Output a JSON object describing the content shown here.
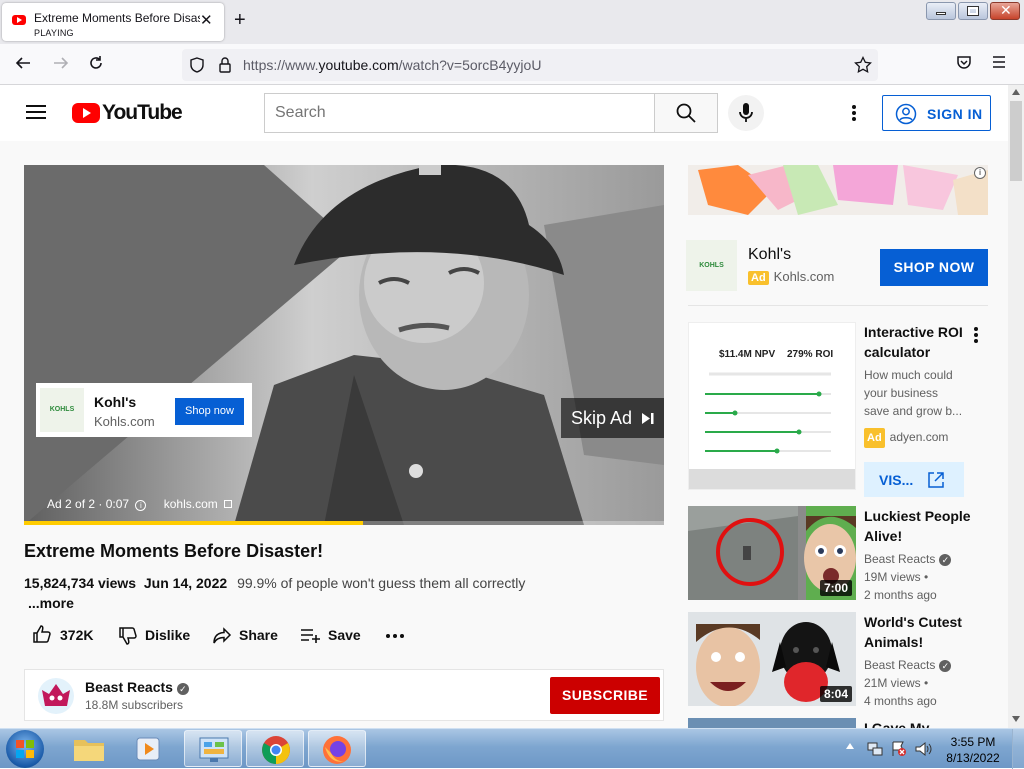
{
  "browser": {
    "tab_title": "Extreme Moments Before Disaster!",
    "tab_status": "PLAYING",
    "url_prefix": "https://www.",
    "url_host": "youtube.com",
    "url_path": "/watch?v=5orcB4yyjoU"
  },
  "header": {
    "logo_text": "YouTube",
    "search_placeholder": "Search",
    "sign_in_label": "SIGN IN"
  },
  "player": {
    "ad_card": {
      "logo_text": "KOHLS",
      "title": "Kohl's",
      "domain": "Kohls.com",
      "button": "Shop now"
    },
    "skip_label": "Skip Ad",
    "ad_counter": "Ad 2 of 2 · 0:07",
    "ad_domain": "kohls.com",
    "progress": 0.53
  },
  "video": {
    "title": "Extreme Moments Before Disaster!",
    "views": "15,824,734 views",
    "date": "Jun 14, 2022",
    "description": "99.9% of people won't guess them all correctly",
    "more_label": "...more",
    "likes": "372K",
    "dislike_label": "Dislike",
    "share_label": "Share",
    "save_label": "Save",
    "channel": {
      "name": "Beast Reacts",
      "subscribers": "18.8M subscribers",
      "subscribe_label": "SUBSCRIBE"
    }
  },
  "sidebar": {
    "ad": {
      "logo_text": "KOHLS",
      "title": "Kohl's",
      "badge": "Ad",
      "domain": "Kohls.com",
      "cta": "SHOP NOW"
    },
    "promo": {
      "npv": "$11.4M NPV",
      "roi": "279% ROI",
      "title": "Interactive ROI calculator",
      "desc_lines": [
        "How much could",
        "your business",
        "save and grow b..."
      ],
      "badge": "Ad",
      "domain": "adyen.com",
      "visit_label": "VIS..."
    },
    "videos": [
      {
        "title": "Luckiest People Alive!",
        "channel": "Beast Reacts",
        "views": "19M views •",
        "age": "2 months ago",
        "duration": "7:00"
      },
      {
        "title": "World's Cutest Animals!",
        "channel": "Beast Reacts",
        "views": "21M views •",
        "age": "4 months ago",
        "duration": "8:04"
      },
      {
        "title": "I Gave My",
        "channel": "",
        "views": "",
        "age": "",
        "duration": ""
      }
    ]
  },
  "taskbar": {
    "time": "3:55 PM",
    "date": "8/13/2022"
  },
  "colors": {
    "yt_red": "#ff0000",
    "subscribe": "#cc0000",
    "link_blue": "#065fd4",
    "ad_yellow": "#f9c02c",
    "progress": "#ffcc00"
  }
}
